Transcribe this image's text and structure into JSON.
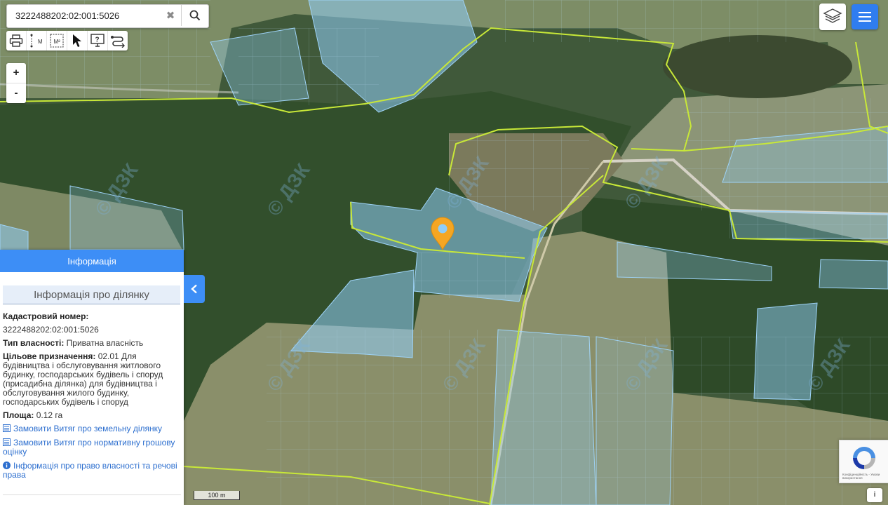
{
  "search": {
    "value": "3222488202:02:001:5026",
    "clear_glyph": "✖"
  },
  "tools": [
    {
      "name": "print-icon",
      "label": ""
    },
    {
      "name": "measure-distance-icon",
      "label": "M"
    },
    {
      "name": "measure-area-icon",
      "label": "M²"
    },
    {
      "name": "pointer-icon",
      "label": ""
    },
    {
      "name": "identify-icon",
      "label": "?"
    },
    {
      "name": "route-icon",
      "label": ""
    }
  ],
  "zoom": {
    "in": "+",
    "out": "-"
  },
  "watermark": "© ДЗК",
  "panel": {
    "header": "Інформація",
    "section_title": "Інформація про ділянку",
    "cadastral_label": "Кадастровий номер:",
    "cadastral_value": "3222488202:02:001:5026",
    "ownership_label": "Тип власності:",
    "ownership_value": "Приватна власність",
    "purpose_label": "Цільове призначення:",
    "purpose_value": "02.01 Для будівництва і обслуговування житлового будинку, господарських будівель і споруд (присадибна ділянка) для будівництва і обслуговування жилого будинку, господарських будівель і споруд",
    "area_label": "Площа:",
    "area_value": "0.12 га",
    "links": [
      "Замовити Витяг про земельну ділянку",
      "Замовити Витяг про нормативну грошову оцінку",
      "Інформація про право власності та речові права"
    ]
  },
  "scale": "100 m",
  "recaptcha_text": "Конфіденційність - Умови використання",
  "info_button": "i",
  "colors": {
    "accent": "#3d8ef6",
    "marker": "#f5a623",
    "parcel_fill": "#8fcdf7",
    "boundary": "#c8e838"
  }
}
